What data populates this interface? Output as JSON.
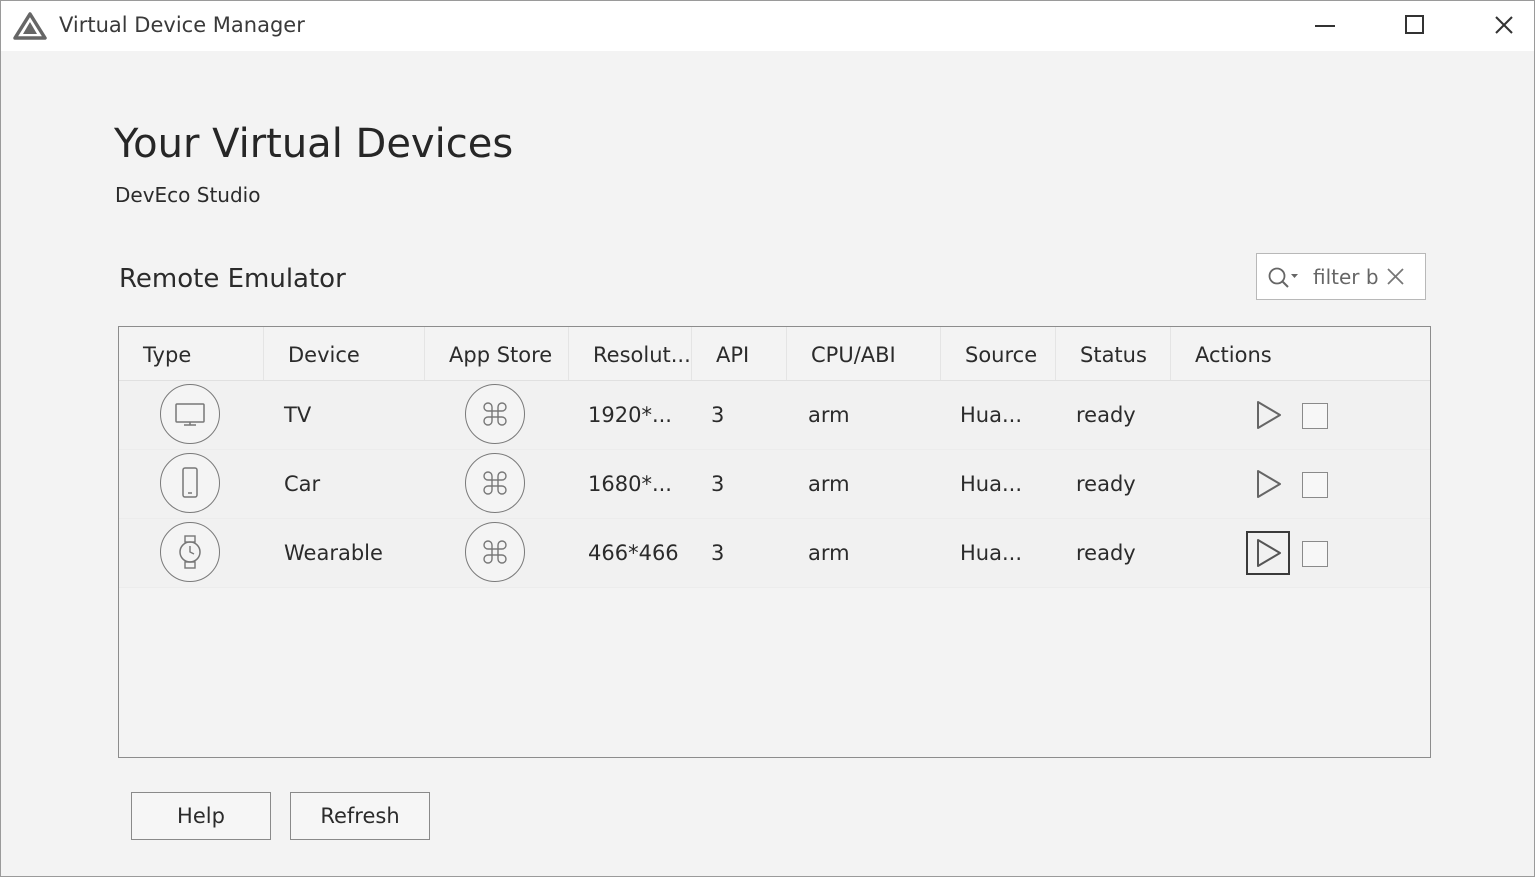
{
  "window": {
    "title": "Virtual Device Manager",
    "controls": {
      "minimize_icon": "minimize-icon",
      "maximize_icon": "maximize-icon",
      "close_icon": "close-icon"
    }
  },
  "header": {
    "title": "Your Virtual Devices",
    "subtitle": "DevEco Studio"
  },
  "section": {
    "title": "Remote Emulator",
    "filter": {
      "placeholder": "filter by",
      "value": ""
    }
  },
  "table": {
    "columns": [
      "Type",
      "Device",
      "App Store",
      "Resolut...",
      "API",
      "CPU/ABI",
      "Source",
      "Status",
      "Actions"
    ],
    "rows": [
      {
        "type_icon": "tv-icon",
        "device": "TV",
        "app_store_icon": "app-store-icon",
        "resolution": "1920*...",
        "api": "3",
        "cpu": "arm",
        "source": "Hua...",
        "status": "ready"
      },
      {
        "type_icon": "phone-icon",
        "device": "Car",
        "app_store_icon": "app-store-icon",
        "resolution": "1680*...",
        "api": "3",
        "cpu": "arm",
        "source": "Hua...",
        "status": "ready"
      },
      {
        "type_icon": "watch-icon",
        "device": "Wearable",
        "app_store_icon": "app-store-icon",
        "resolution": "466*466",
        "api": "3",
        "cpu": "arm",
        "source": "Hua...",
        "status": "ready"
      }
    ]
  },
  "footer": {
    "help_label": "Help",
    "refresh_label": "Refresh"
  }
}
